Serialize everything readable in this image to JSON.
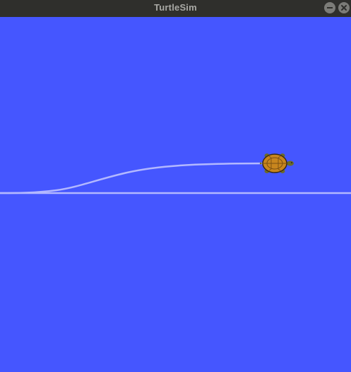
{
  "window": {
    "title": "TurtleSim",
    "buttons": {
      "minimize": "minimize-icon",
      "close": "close-icon"
    }
  },
  "canvas": {
    "background_color": "#4556ff",
    "pen_color": "#b3b8ff",
    "turtle": {
      "icon": "turtle-icon",
      "shell_color": "#c8861e",
      "body_color": "#6b6a2a"
    }
  }
}
